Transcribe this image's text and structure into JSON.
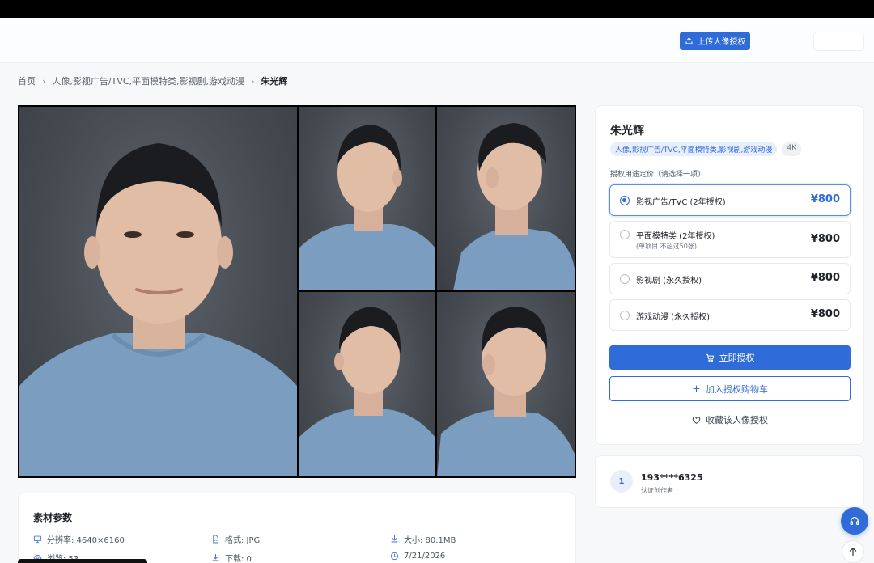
{
  "header": {
    "upload_label": "上传人像授权",
    "upload_icon": "upload-icon"
  },
  "breadcrumb": {
    "home": "首页",
    "category": "人像,影视广告/TVC,平面模特类,影视剧,游戏动漫",
    "current": "朱光辉"
  },
  "gallery": {
    "photos": [
      "front-portrait",
      "three-quarter-left",
      "profile-right",
      "three-quarter-left-low",
      "profile-right-low"
    ]
  },
  "product": {
    "name": "朱光辉",
    "category_tag": "人像,影视广告/TVC,平面模特类,影视剧,游戏动漫",
    "resolution_tag": "4K",
    "price_label": "授权用途定价（请选择一项）",
    "options": [
      {
        "label": "影视广告/TVC (2年授权)",
        "sub": "",
        "price": "¥800",
        "selected": true
      },
      {
        "label": "平面模特类 (2年授权)",
        "sub": "(单项目 不超过50张)",
        "price": "¥800",
        "selected": false
      },
      {
        "label": "影视剧 (永久授权)",
        "sub": "",
        "price": "¥800",
        "selected": false
      },
      {
        "label": "游戏动漫 (永久授权)",
        "sub": "",
        "price": "¥800",
        "selected": false
      }
    ],
    "buy_label": "立即授权",
    "cart_label": "加入授权购物车",
    "favorite_label": "收藏该人像授权"
  },
  "creator": {
    "avatar_text": "1",
    "phone": "193****6325",
    "role": "认证创作者"
  },
  "params": {
    "title": "素材参数",
    "resolution": "分辨率: 4640×6160",
    "format": "格式: JPG",
    "size": "大小: 80.1MB",
    "views": "浏览: 53",
    "downloads": "下载: 0",
    "date": "7/21/2026"
  },
  "colors": {
    "accent": "#2f6bd9",
    "shirt": "#7a9dc0",
    "backdrop": "#4a4f56"
  }
}
